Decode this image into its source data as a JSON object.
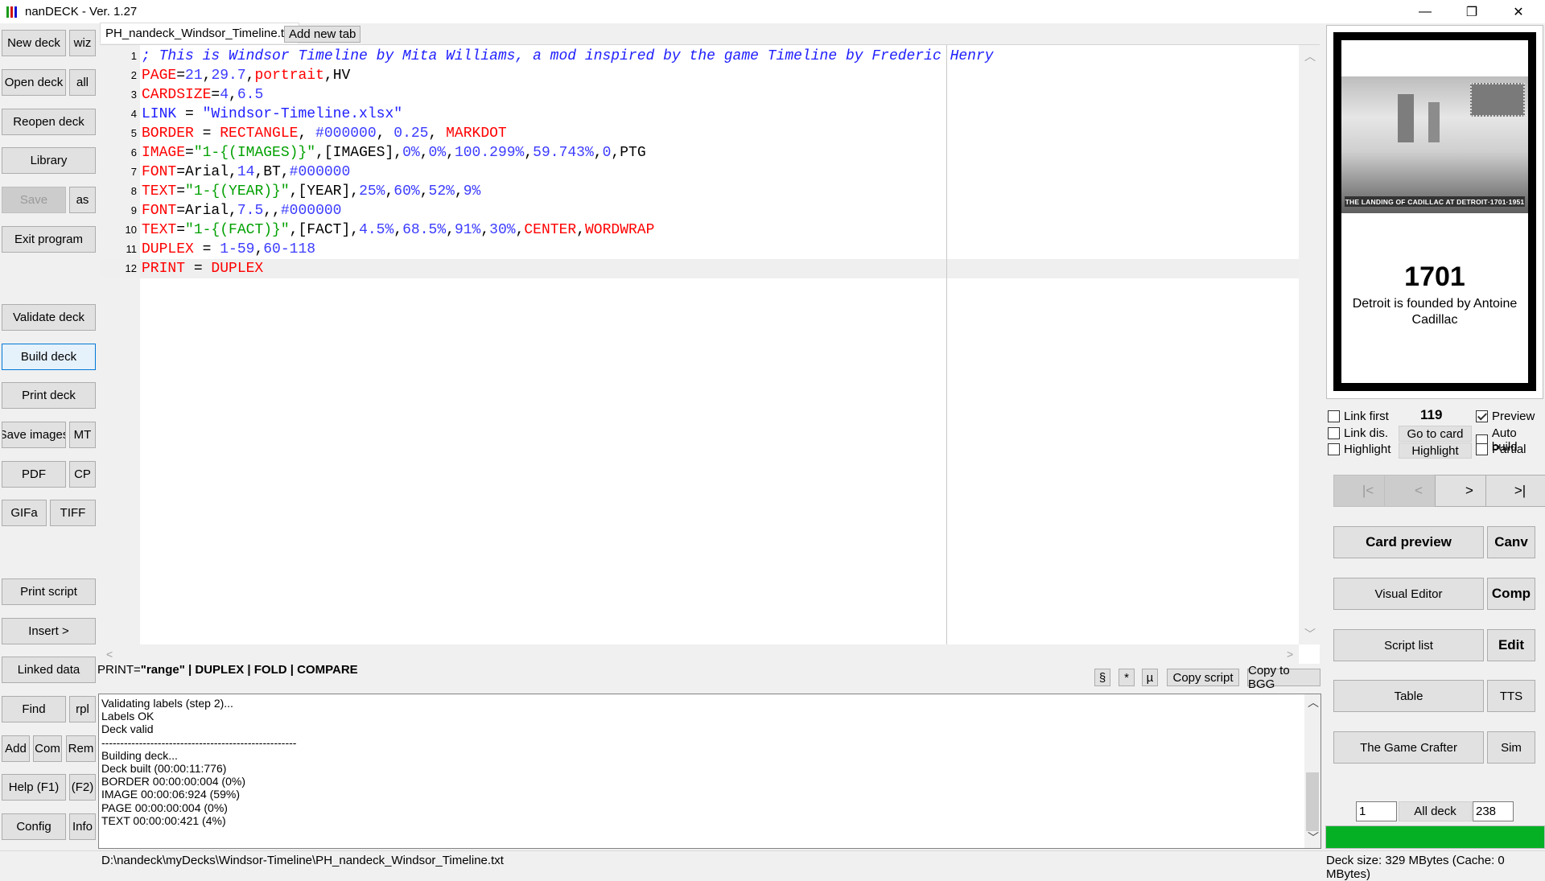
{
  "window": {
    "title": "nanDECK - Ver. 1.27",
    "controls": {
      "minimize": "—",
      "maximize": "❐",
      "close": "✕"
    }
  },
  "sidebar": {
    "new_deck": "New deck",
    "wiz": "wiz",
    "open_deck": "Open deck",
    "all": "all",
    "reopen_deck": "Reopen deck",
    "library": "Library",
    "save": "Save",
    "save_as": "as",
    "exit_program": "Exit program",
    "validate_deck": "Validate deck",
    "build_deck": "Build deck",
    "print_deck": "Print deck",
    "save_images": "Save images",
    "mt": "MT",
    "pdf": "PDF",
    "cp": "CP",
    "gifa": "GIFa",
    "tiff": "TIFF",
    "print_script": "Print script",
    "insert": "Insert >",
    "linked_data": "Linked data",
    "find": "Find",
    "rpl": "rpl",
    "add": "Add",
    "com": "Com",
    "rem": "Rem",
    "help": "Help (F1)",
    "f2": "(F2)",
    "config": "Config",
    "info": "Info"
  },
  "tabs": {
    "active": "PH_nandeck_Windsor_Timeline.txt",
    "add_new": "Add new tab"
  },
  "editor": {
    "lines": [
      {
        "n": "1",
        "tokens": [
          [
            "cmt",
            "; This is Windsor Timeline by Mita Williams, a mod inspired by the game Timeline by Frederic Henry"
          ]
        ]
      },
      {
        "n": "2",
        "tokens": [
          [
            "kw",
            "PAGE"
          ],
          [
            "plain",
            "="
          ],
          [
            "num",
            "21"
          ],
          [
            "plain",
            ","
          ],
          [
            "num",
            "29.7"
          ],
          [
            "plain",
            ","
          ],
          [
            "kw",
            "portrait"
          ],
          [
            "plain",
            ",HV"
          ]
        ]
      },
      {
        "n": "3",
        "tokens": [
          [
            "kw",
            "CARDSIZE"
          ],
          [
            "plain",
            "="
          ],
          [
            "num",
            "4"
          ],
          [
            "plain",
            ","
          ],
          [
            "num",
            "6.5"
          ]
        ]
      },
      {
        "n": "4",
        "tokens": [
          [
            "str",
            "LINK"
          ],
          [
            "plain",
            " = "
          ],
          [
            "str",
            "\"Windsor-Timeline.xlsx\""
          ]
        ]
      },
      {
        "n": "5",
        "tokens": [
          [
            "kw",
            "BORDER"
          ],
          [
            "plain",
            " = "
          ],
          [
            "kw",
            "RECTANGLE"
          ],
          [
            "plain",
            ", "
          ],
          [
            "num",
            "#000000"
          ],
          [
            "plain",
            ", "
          ],
          [
            "num",
            "0.25"
          ],
          [
            "plain",
            ", "
          ],
          [
            "kw",
            "MARKDOT"
          ]
        ]
      },
      {
        "n": "6",
        "tokens": [
          [
            "kw",
            "IMAGE"
          ],
          [
            "plain",
            "="
          ],
          [
            "grn",
            "\"1-{(IMAGES)}\""
          ],
          [
            "plain",
            ",[IMAGES],"
          ],
          [
            "num",
            "0%"
          ],
          [
            "plain",
            ","
          ],
          [
            "num",
            "0%"
          ],
          [
            "plain",
            ","
          ],
          [
            "num",
            "100.299%"
          ],
          [
            "plain",
            ","
          ],
          [
            "num",
            "59.743%"
          ],
          [
            "plain",
            ","
          ],
          [
            "num",
            "0"
          ],
          [
            "plain",
            ",PTG"
          ]
        ]
      },
      {
        "n": "7",
        "tokens": [
          [
            "kw",
            "FONT"
          ],
          [
            "plain",
            "=Arial,"
          ],
          [
            "num",
            "14"
          ],
          [
            "plain",
            ",BT,"
          ],
          [
            "num",
            "#000000"
          ]
        ]
      },
      {
        "n": "8",
        "tokens": [
          [
            "kw",
            "TEXT"
          ],
          [
            "plain",
            "="
          ],
          [
            "grn",
            "\"1-{(YEAR)}\""
          ],
          [
            "plain",
            ",[YEAR],"
          ],
          [
            "num",
            "25%"
          ],
          [
            "plain",
            ","
          ],
          [
            "num",
            "60%"
          ],
          [
            "plain",
            ","
          ],
          [
            "num",
            "52%"
          ],
          [
            "plain",
            ","
          ],
          [
            "num",
            "9%"
          ]
        ]
      },
      {
        "n": "9",
        "tokens": [
          [
            "kw",
            "FONT"
          ],
          [
            "plain",
            "=Arial,"
          ],
          [
            "num",
            "7.5"
          ],
          [
            "plain",
            ",,"
          ],
          [
            "num",
            "#000000"
          ]
        ]
      },
      {
        "n": "10",
        "tokens": [
          [
            "kw",
            "TEXT"
          ],
          [
            "plain",
            "="
          ],
          [
            "grn",
            "\"1-{(FACT)}\""
          ],
          [
            "plain",
            ",[FACT],"
          ],
          [
            "num",
            "4.5%"
          ],
          [
            "plain",
            ","
          ],
          [
            "num",
            "68.5%"
          ],
          [
            "plain",
            ","
          ],
          [
            "num",
            "91%"
          ],
          [
            "plain",
            ","
          ],
          [
            "num",
            "30%"
          ],
          [
            "plain",
            ","
          ],
          [
            "kw",
            "CENTER"
          ],
          [
            "plain",
            ","
          ],
          [
            "kw",
            "WORDWRAP"
          ]
        ]
      },
      {
        "n": "11",
        "tokens": [
          [
            "kw",
            "DUPLEX"
          ],
          [
            "plain",
            " = "
          ],
          [
            "num",
            "1-59"
          ],
          [
            "plain",
            ","
          ],
          [
            "num",
            "60-118"
          ]
        ]
      },
      {
        "n": "12",
        "tokens": [
          [
            "kw",
            "PRINT"
          ],
          [
            "plain",
            " = "
          ],
          [
            "kw",
            "DUPLEX"
          ]
        ]
      }
    ]
  },
  "hint": {
    "prefix": "PRINT=",
    "bold": "\"range\" | DUPLEX | FOLD | COMPARE"
  },
  "toolbar": {
    "section": "§",
    "star": "*",
    "mu": "µ",
    "copy_script": "Copy script",
    "copy_bgg": "Copy to BGG"
  },
  "log": {
    "lines": [
      "Validating labels (step 2)...",
      "Labels OK",
      "Deck valid",
      "----------------------------------------------------",
      "Building deck...",
      "Deck built (00:00:11:776)",
      "BORDER 00:00:00:004 (0%)",
      "IMAGE 00:00:06:924 (59%)",
      "PAGE 00:00:00:004 (0%)",
      "TEXT 00:00:00:421 (4%)"
    ]
  },
  "status": {
    "path": "D:\\nandeck\\myDecks\\Windsor-Timeline\\PH_nandeck_Windsor_Timeline.txt",
    "deck_size": "Deck size: 329 MBytes (Cache: 0 MBytes)"
  },
  "preview": {
    "image_caption": "THE LANDING OF CADILLAC AT DETROIT·1701·1951",
    "year": "1701",
    "fact": "Detroit is founded by Antoine Cadillac"
  },
  "controls": {
    "link_first": "Link first",
    "link_dis": "Link dis.",
    "highlight_chk": "Highlight",
    "card_number": "119",
    "go_to_card": "Go to card",
    "highlight_btn": "Highlight",
    "preview": "Preview",
    "preview_checked": true,
    "auto_build": "Auto build",
    "partial": "Partial",
    "nav_first": "|<",
    "nav_prev": "<",
    "nav_next": ">",
    "nav_last": ">|"
  },
  "right_buttons": {
    "card_preview": "Card preview",
    "canv": "Canv",
    "visual_editor": "Visual Editor",
    "comp": "Comp",
    "script_list": "Script list",
    "edit": "Edit",
    "table": "Table",
    "tts": "TTS",
    "game_crafter": "The Game Crafter",
    "sim": "Sim"
  },
  "range": {
    "from": "1",
    "all_deck": "All deck",
    "to": "238",
    "progress_percent": 100,
    "progress_color": "#06b025"
  }
}
